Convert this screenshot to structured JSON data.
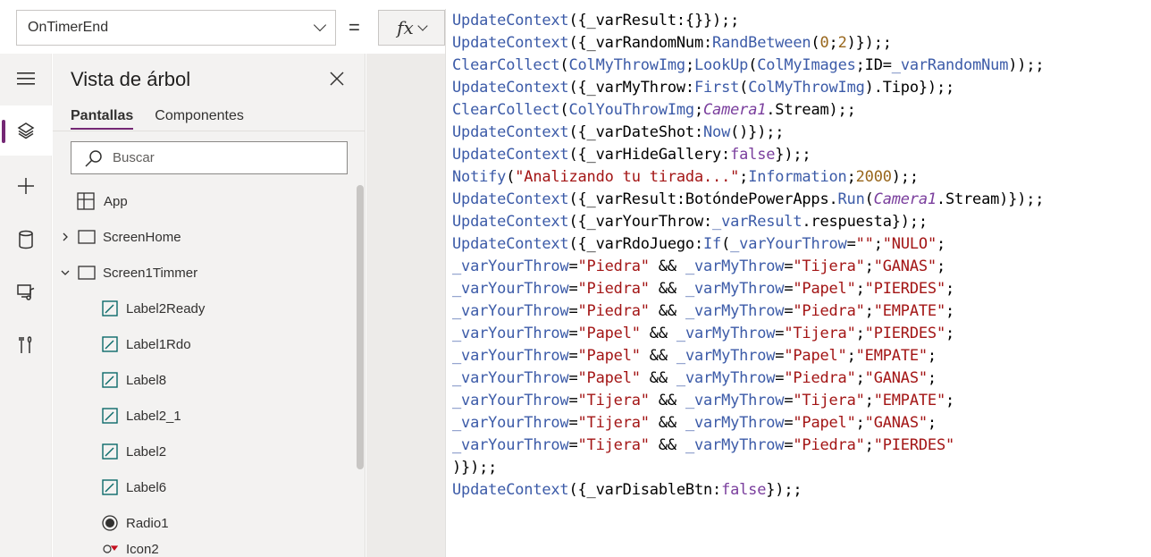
{
  "toolbar": {
    "property_selected": "OnTimerEnd",
    "equals": "=",
    "fx_label": "fx"
  },
  "rail": {
    "items": [
      {
        "icon": "hamburger-icon"
      },
      {
        "icon": "layers-icon",
        "active": true
      },
      {
        "icon": "plus-icon"
      },
      {
        "icon": "database-icon"
      },
      {
        "icon": "media-icon"
      },
      {
        "icon": "tools-icon"
      }
    ]
  },
  "tree": {
    "title": "Vista de árbol",
    "tabs": [
      "Pantallas",
      "Componentes"
    ],
    "search_placeholder": "Buscar",
    "items": [
      {
        "label": "App",
        "icon": "app-icon"
      },
      {
        "label": "ScreenHome",
        "icon": "screen-icon",
        "expander": "collapsed"
      },
      {
        "label": "Screen1Timmer",
        "icon": "screen-icon",
        "expander": "expanded"
      },
      {
        "label": "Label2Ready",
        "icon": "label-icon"
      },
      {
        "label": "Label1Rdo",
        "icon": "label-icon"
      },
      {
        "label": "Label8",
        "icon": "label-icon"
      },
      {
        "label": "Label2_1",
        "icon": "label-icon"
      },
      {
        "label": "Label2",
        "icon": "label-icon"
      },
      {
        "label": "Label6",
        "icon": "label-icon"
      },
      {
        "label": "Radio1",
        "icon": "radio-icon"
      },
      {
        "label": "Icon2",
        "icon": "icon-control-icon"
      }
    ]
  },
  "formula": {
    "lines": [
      [
        [
          "fn",
          "UpdateContext"
        ],
        [
          "p",
          "({_varResult:{}});;"
        ]
      ],
      [
        [
          "fn",
          "UpdateContext"
        ],
        [
          "p",
          "({_varRandomNum:"
        ],
        [
          "fn",
          "RandBetween"
        ],
        [
          "p",
          "("
        ],
        [
          "num",
          "0"
        ],
        [
          "p",
          ";"
        ],
        [
          "num",
          "2"
        ],
        [
          "p",
          ")});;"
        ]
      ],
      [
        [
          "fn",
          "ClearCollect"
        ],
        [
          "p",
          "("
        ],
        [
          "fn",
          "ColMyThrowImg"
        ],
        [
          "p",
          ";"
        ],
        [
          "fn",
          "LookUp"
        ],
        [
          "p",
          "("
        ],
        [
          "fn",
          "ColMyImages"
        ],
        [
          "p",
          ";ID="
        ],
        [
          "fn",
          "_varRandomNum"
        ],
        [
          "p",
          "));;"
        ]
      ],
      [
        [
          "fn",
          "UpdateContext"
        ],
        [
          "p",
          "({_varMyThrow:"
        ],
        [
          "fn",
          "First"
        ],
        [
          "p",
          "("
        ],
        [
          "fn",
          "ColMyThrowImg"
        ],
        [
          "p",
          ").Tipo});;"
        ]
      ],
      [
        [
          "fn",
          "ClearCollect"
        ],
        [
          "p",
          "("
        ],
        [
          "fn",
          "ColYouThrowImg"
        ],
        [
          "p",
          ";"
        ],
        [
          "ctl",
          "Camera1"
        ],
        [
          "p",
          ".Stream);;"
        ]
      ],
      [
        [
          "fn",
          "UpdateContext"
        ],
        [
          "p",
          "({_varDateShot:"
        ],
        [
          "fn",
          "Now"
        ],
        [
          "p",
          "()});;"
        ]
      ],
      [
        [
          "fn",
          "UpdateContext"
        ],
        [
          "p",
          "({_varHideGallery:"
        ],
        [
          "kw",
          "false"
        ],
        [
          "p",
          "});;"
        ]
      ],
      [
        [
          "fn",
          "Notify"
        ],
        [
          "p",
          "("
        ],
        [
          "str",
          "\"Analizando tu tirada...\""
        ],
        [
          "p",
          ";"
        ],
        [
          "fn",
          "Information"
        ],
        [
          "p",
          ";"
        ],
        [
          "num",
          "2000"
        ],
        [
          "p",
          ");;"
        ]
      ],
      [
        [
          "fn",
          "UpdateContext"
        ],
        [
          "p",
          "({_varResult:BotóndePowerApps."
        ],
        [
          "fn",
          "Run"
        ],
        [
          "p",
          "("
        ],
        [
          "ctl",
          "Camera1"
        ],
        [
          "p",
          ".Stream)});;"
        ]
      ],
      [
        [
          "fn",
          "UpdateContext"
        ],
        [
          "p",
          "({_varYourThrow:"
        ],
        [
          "fn",
          "_varResult"
        ],
        [
          "p",
          ".respuesta});;"
        ]
      ],
      [
        [
          "fn",
          "UpdateContext"
        ],
        [
          "p",
          "({_varRdoJuego:"
        ],
        [
          "fn",
          "If"
        ],
        [
          "p",
          "("
        ],
        [
          "fn",
          "_varYourThrow"
        ],
        [
          "p",
          "="
        ],
        [
          "str",
          "\"\""
        ],
        [
          "p",
          ";"
        ],
        [
          "str",
          "\"NULO\""
        ],
        [
          "p",
          ";"
        ]
      ],
      [
        [
          "fn",
          "_varYourThrow"
        ],
        [
          "p",
          "="
        ],
        [
          "str",
          "\"Piedra\""
        ],
        [
          "p",
          " && "
        ],
        [
          "fn",
          "_varMyThrow"
        ],
        [
          "p",
          "="
        ],
        [
          "str",
          "\"Tijera\""
        ],
        [
          "p",
          ";"
        ],
        [
          "str",
          "\"GANAS\""
        ],
        [
          "p",
          ";"
        ]
      ],
      [
        [
          "fn",
          "_varYourThrow"
        ],
        [
          "p",
          "="
        ],
        [
          "str",
          "\"Piedra\""
        ],
        [
          "p",
          " && "
        ],
        [
          "fn",
          "_varMyThrow"
        ],
        [
          "p",
          "="
        ],
        [
          "str",
          "\"Papel\""
        ],
        [
          "p",
          ";"
        ],
        [
          "str",
          "\"PIERDES\""
        ],
        [
          "p",
          ";"
        ]
      ],
      [
        [
          "fn",
          "_varYourThrow"
        ],
        [
          "p",
          "="
        ],
        [
          "str",
          "\"Piedra\""
        ],
        [
          "p",
          " && "
        ],
        [
          "fn",
          "_varMyThrow"
        ],
        [
          "p",
          "="
        ],
        [
          "str",
          "\"Piedra\""
        ],
        [
          "p",
          ";"
        ],
        [
          "str",
          "\"EMPATE\""
        ],
        [
          "p",
          ";"
        ]
      ],
      [
        [
          "fn",
          "_varYourThrow"
        ],
        [
          "p",
          "="
        ],
        [
          "str",
          "\"Papel\""
        ],
        [
          "p",
          " && "
        ],
        [
          "fn",
          "_varMyThrow"
        ],
        [
          "p",
          "="
        ],
        [
          "str",
          "\"Tijera\""
        ],
        [
          "p",
          ";"
        ],
        [
          "str",
          "\"PIERDES\""
        ],
        [
          "p",
          ";"
        ]
      ],
      [
        [
          "fn",
          "_varYourThrow"
        ],
        [
          "p",
          "="
        ],
        [
          "str",
          "\"Papel\""
        ],
        [
          "p",
          " && "
        ],
        [
          "fn",
          "_varMyThrow"
        ],
        [
          "p",
          "="
        ],
        [
          "str",
          "\"Papel\""
        ],
        [
          "p",
          ";"
        ],
        [
          "str",
          "\"EMPATE\""
        ],
        [
          "p",
          ";"
        ]
      ],
      [
        [
          "fn",
          "_varYourThrow"
        ],
        [
          "p",
          "="
        ],
        [
          "str",
          "\"Papel\""
        ],
        [
          "p",
          " && "
        ],
        [
          "fn",
          "_varMyThrow"
        ],
        [
          "p",
          "="
        ],
        [
          "str",
          "\"Piedra\""
        ],
        [
          "p",
          ";"
        ],
        [
          "str",
          "\"GANAS\""
        ],
        [
          "p",
          ";"
        ]
      ],
      [
        [
          "fn",
          "_varYourThrow"
        ],
        [
          "p",
          "="
        ],
        [
          "str",
          "\"Tijera\""
        ],
        [
          "p",
          " && "
        ],
        [
          "fn",
          "_varMyThrow"
        ],
        [
          "p",
          "="
        ],
        [
          "str",
          "\"Tijera\""
        ],
        [
          "p",
          ";"
        ],
        [
          "str",
          "\"EMPATE\""
        ],
        [
          "p",
          ";"
        ]
      ],
      [
        [
          "fn",
          "_varYourThrow"
        ],
        [
          "p",
          "="
        ],
        [
          "str",
          "\"Tijera\""
        ],
        [
          "p",
          " && "
        ],
        [
          "fn",
          "_varMyThrow"
        ],
        [
          "p",
          "="
        ],
        [
          "str",
          "\"Papel\""
        ],
        [
          "p",
          ";"
        ],
        [
          "str",
          "\"GANAS\""
        ],
        [
          "p",
          ";"
        ]
      ],
      [
        [
          "fn",
          "_varYourThrow"
        ],
        [
          "p",
          "="
        ],
        [
          "str",
          "\"Tijera\""
        ],
        [
          "p",
          " && "
        ],
        [
          "fn",
          "_varMyThrow"
        ],
        [
          "p",
          "="
        ],
        [
          "str",
          "\"Piedra\""
        ],
        [
          "p",
          ";"
        ],
        [
          "str",
          "\"PIERDES\""
        ]
      ],
      [
        [
          "p",
          ")});;"
        ]
      ],
      [
        [
          "fn",
          "UpdateContext"
        ],
        [
          "p",
          "({_varDisableBtn:"
        ],
        [
          "kw",
          "false"
        ],
        [
          "p",
          "});;"
        ]
      ]
    ]
  },
  "colors": {
    "accent": "#742774",
    "function": "#3c5ba8",
    "string": "#a31515",
    "number": "#98661b",
    "keyword": "#7a3e9d"
  }
}
